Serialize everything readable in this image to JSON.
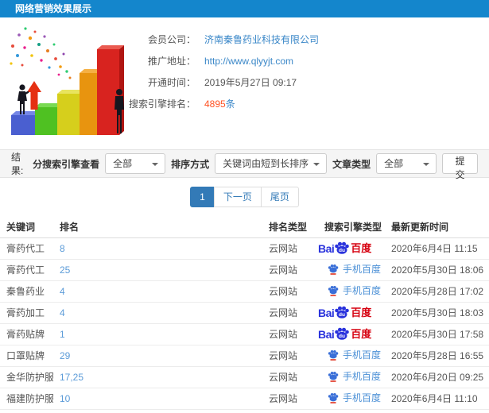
{
  "page": {
    "title": "网络营销效果展示"
  },
  "summary": {
    "fields": [
      {
        "label": "会员公司：",
        "value": "济南秦鲁药业科技有限公司"
      },
      {
        "label": "推广地址：",
        "value": "http://www.qlyyjt.com"
      },
      {
        "label": "开通时间：",
        "value": "2019年5月27日 09:17"
      },
      {
        "label": "搜索引擎排名：",
        "value": "4895",
        "suffix": "条"
      }
    ]
  },
  "filters": {
    "section_label": "结果:",
    "engine_label": "分搜索引擎查看",
    "engine_value": "全部",
    "sort_label": "排序方式",
    "sort_value": "关键词由短到长排序",
    "article_label": "文章类型",
    "article_value": "全部",
    "submit_label": "提交"
  },
  "pagination": {
    "current": "1",
    "next": "下一页",
    "last": "尾页"
  },
  "logos": {
    "baidu_pc_latin": "Bai",
    "baidu_pc_du": "du",
    "baidu_pc_cn": "百度",
    "baidu_mobile_label": "手机百度"
  },
  "table": {
    "headers": [
      "关键词",
      "排名",
      "排名类型",
      "搜索引擎类型",
      "最新更新时间"
    ],
    "rows": [
      {
        "keyword": "膏药代工",
        "rank": "8",
        "rank_type": "云网站",
        "engine": "百度",
        "updated": "2020年6月4日 11:15"
      },
      {
        "keyword": "膏药代工",
        "rank": "25",
        "rank_type": "云网站",
        "engine": "手机百度",
        "updated": "2020年5月30日 18:06"
      },
      {
        "keyword": "秦鲁药业",
        "rank": "4",
        "rank_type": "云网站",
        "engine": "手机百度",
        "updated": "2020年5月28日 17:02"
      },
      {
        "keyword": "膏药加工",
        "rank": "4",
        "rank_type": "云网站",
        "engine": "百度",
        "updated": "2020年5月30日 18:03"
      },
      {
        "keyword": "膏药贴牌",
        "rank": "1",
        "rank_type": "云网站",
        "engine": "百度",
        "updated": "2020年5月30日 17:58"
      },
      {
        "keyword": "口罩贴牌",
        "rank": "29",
        "rank_type": "云网站",
        "engine": "手机百度",
        "updated": "2020年5月28日 16:55"
      },
      {
        "keyword": "金华防护服",
        "rank": "17,25",
        "rank_type": "云网站",
        "engine": "手机百度",
        "updated": "2020年6月20日 09:25"
      },
      {
        "keyword": "福建防护服",
        "rank": "10",
        "rank_type": "云网站",
        "engine": "手机百度",
        "updated": "2020年6月4日 11:10"
      }
    ]
  },
  "colors": {
    "topbar_blue": "#1486cc",
    "link_blue": "#3a87c8",
    "rank_blue": "#5b9bd8",
    "pagination_active": "#337ab7",
    "highlight_red": "#ff5122",
    "baidu_blue": "#2932dc",
    "baidu_red": "#d6000f",
    "mobile_baidu_blue": "#4a8fd6",
    "filter_bar_bg": "#f5f5f5"
  }
}
